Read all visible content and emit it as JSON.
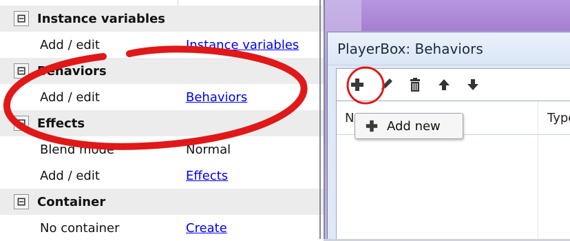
{
  "property_grid": {
    "rows": [
      {
        "type": "category",
        "label": "Instance variables",
        "expander": "⊟"
      },
      {
        "type": "item",
        "name": "Add / edit",
        "value": "Instance variables",
        "value_is_link": true
      },
      {
        "type": "category",
        "label": "Behaviors",
        "expander": "⊟"
      },
      {
        "type": "item",
        "name": "Add / edit",
        "value": "Behaviors",
        "value_is_link": true
      },
      {
        "type": "category",
        "label": "Effects",
        "expander": "⊟"
      },
      {
        "type": "item",
        "name": "Blend mode",
        "value": "Normal",
        "value_is_link": false
      },
      {
        "type": "item",
        "name": "Add / edit",
        "value": "Effects",
        "value_is_link": true
      },
      {
        "type": "category",
        "label": "Container",
        "expander": "⊟"
      },
      {
        "type": "item",
        "name": "No container",
        "value": "Create",
        "value_is_link": true
      }
    ]
  },
  "dialog": {
    "title": "PlayerBox: Behaviors",
    "toolbar": {
      "add_icon": "plus-icon",
      "edit_icon": "pencil-icon",
      "delete_icon": "trash-icon",
      "up_icon": "arrow-up-icon",
      "down_icon": "arrow-down-icon"
    },
    "list_header": {
      "name_col": "N",
      "type_col": "Type"
    }
  },
  "tooltip": {
    "label": "Add new"
  },
  "colors": {
    "link": "#0000ee",
    "annotation_red": "#e01818",
    "purple_bg": "#b79ad8",
    "dialog_bg": "#dfe8f7"
  }
}
